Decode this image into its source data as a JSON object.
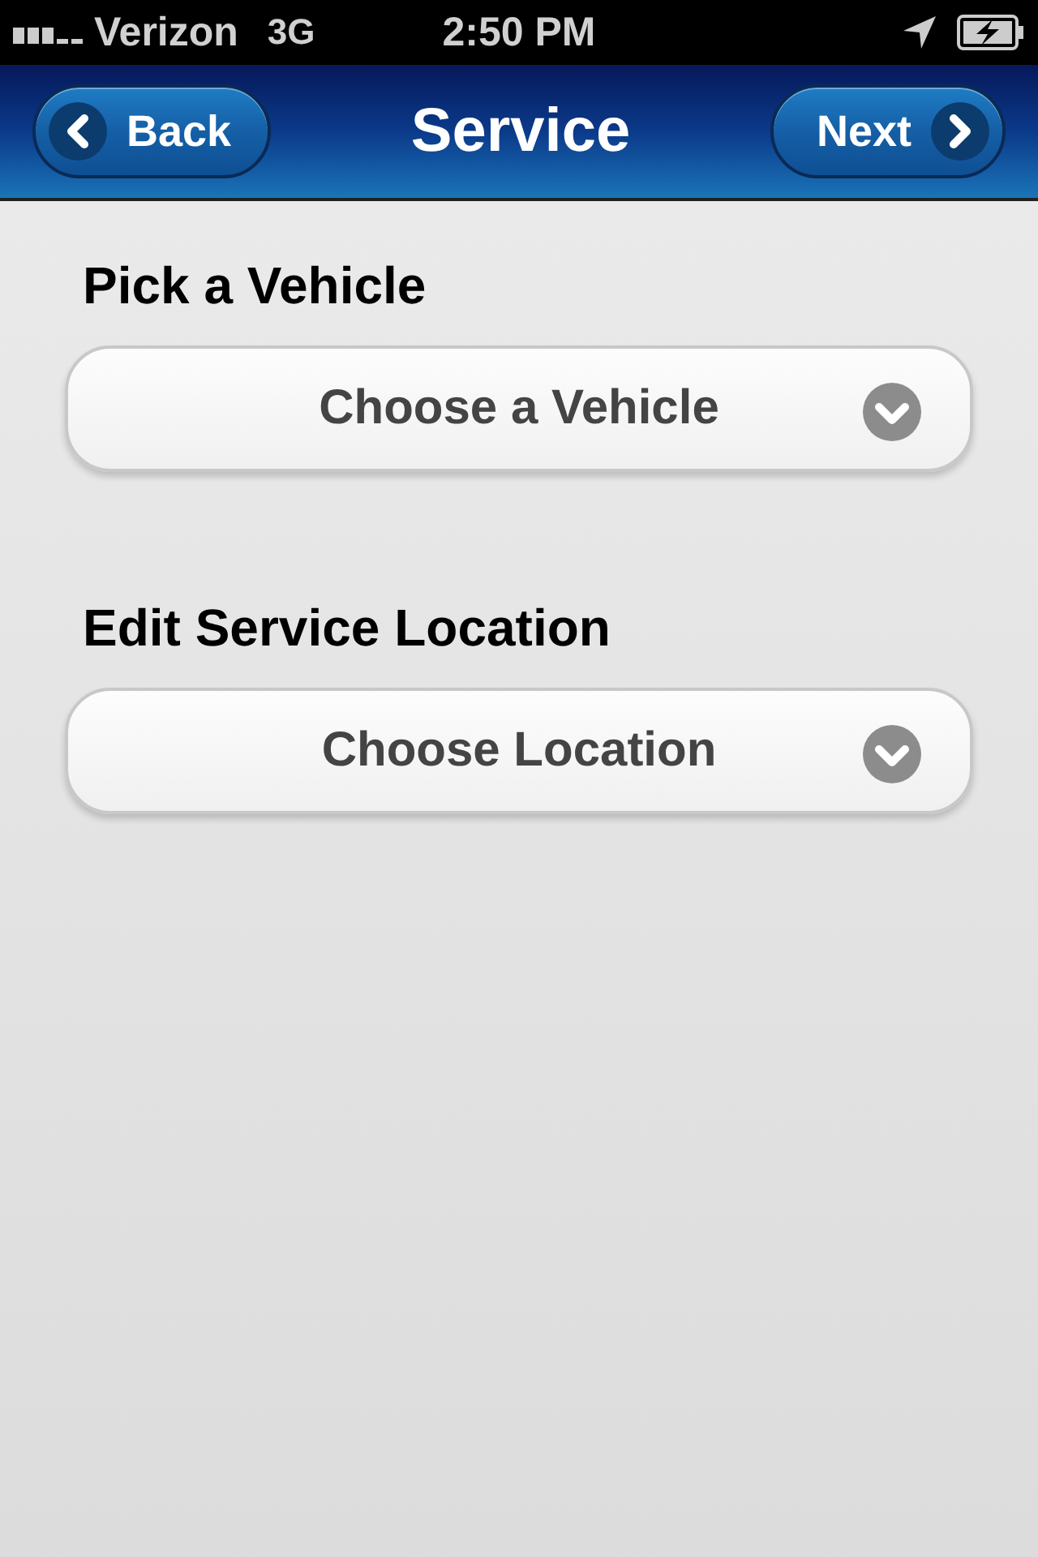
{
  "status_bar": {
    "carrier": "Verizon",
    "network": "3G",
    "time": "2:50 PM"
  },
  "nav_bar": {
    "title": "Service",
    "back_button": "Back",
    "next_button": "Next"
  },
  "sections": [
    {
      "label": "Pick a Vehicle",
      "select": {
        "placeholder": "Choose a Vehicle"
      }
    },
    {
      "label": "Edit Service Location",
      "select": {
        "placeholder": "Choose Location"
      }
    }
  ]
}
